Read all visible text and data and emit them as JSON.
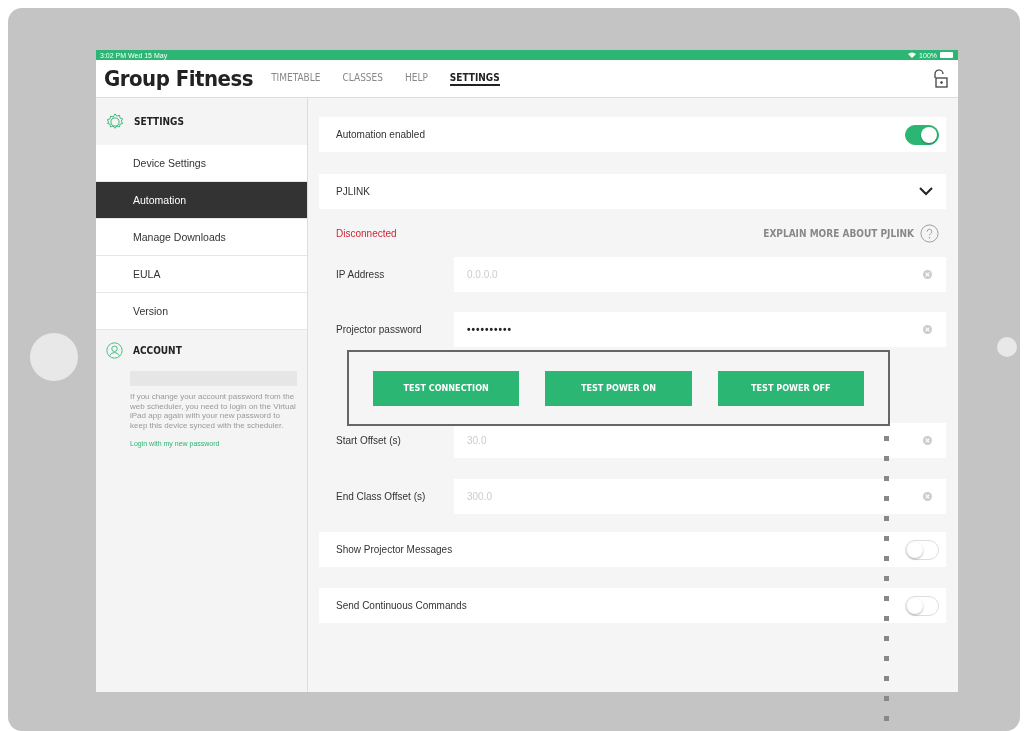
{
  "status_bar": {
    "time": "3:02 PM  Wed 15 May",
    "battery": "100%"
  },
  "header": {
    "title": "Group Fitness",
    "tabs": [
      {
        "label": "TIMETABLE",
        "selected": false
      },
      {
        "label": "CLASSES",
        "selected": false
      },
      {
        "label": "HELP",
        "selected": false
      },
      {
        "label": "SETTINGS",
        "selected": true
      }
    ]
  },
  "sidebar": {
    "settings_heading": "SETTINGS",
    "items": [
      {
        "label": "Device Settings",
        "selected": false
      },
      {
        "label": "Automation",
        "selected": true
      },
      {
        "label": "Manage Downloads",
        "selected": false
      },
      {
        "label": "EULA",
        "selected": false
      },
      {
        "label": "Version",
        "selected": false
      }
    ],
    "account_heading": "ACCOUNT",
    "account_note": "If you change your account password from the web scheduler, you need to login on the Virtual iPad app again with your new password to keep this device synced with the scheduler.",
    "account_link": "Login with my new password"
  },
  "content": {
    "automation": {
      "label": "Automation enabled",
      "on": true
    },
    "protocol": {
      "label": "PJLINK",
      "expanded": true
    },
    "connection_status": "Disconnected",
    "help_link": "EXPLAIN MORE ABOUT PJLINK",
    "fields": [
      {
        "label": "IP Address",
        "placeholder": "0.0.0.0"
      },
      {
        "label": "Projector password",
        "value": "••••••••••"
      }
    ],
    "buttons": [
      "TEST CONNECTION",
      "TEST POWER ON",
      "TEST POWER OFF"
    ],
    "offset_fields": [
      {
        "label": "Start Offset (s)",
        "placeholder": "30.0"
      },
      {
        "label": "End Class Offset (s)",
        "placeholder": "300.0"
      }
    ],
    "switches": [
      {
        "label": "Show Projector Messages",
        "on": false
      },
      {
        "label": "Send Continuous Commands",
        "on": false
      }
    ]
  }
}
